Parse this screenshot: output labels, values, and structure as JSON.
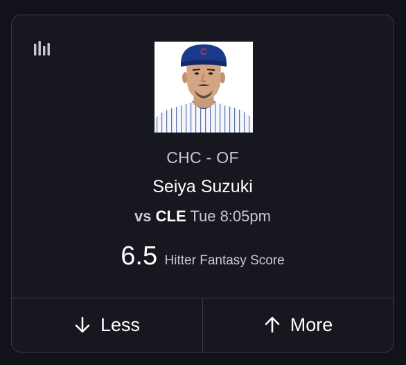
{
  "player": {
    "team_position": "CHC - OF",
    "name": "Seiya Suzuki",
    "matchup_prefix": "vs",
    "opponent": "CLE",
    "game_time": "Tue 8:05pm",
    "cap_logo_letter": "C"
  },
  "projection": {
    "value": "6.5",
    "stat_label": "Hitter Fantasy Score"
  },
  "actions": {
    "less_label": "Less",
    "more_label": "More"
  },
  "icons": {
    "stats": "bar-chart-icon",
    "less": "arrow-down-icon",
    "more": "arrow-up-icon"
  },
  "colors": {
    "background": "#12121a",
    "card": "#17171f",
    "border": "#3b3b46",
    "text_primary": "#ffffff",
    "text_secondary": "#c9c9d1",
    "cap_blue": "#1b3a8c",
    "cap_red": "#cc3433"
  }
}
